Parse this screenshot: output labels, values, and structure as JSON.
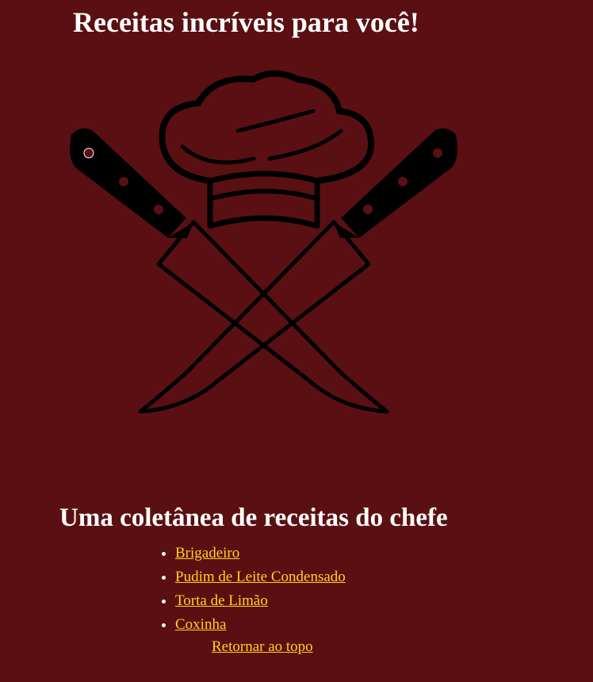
{
  "header": {
    "title": "Receitas incríveis para você!"
  },
  "logo": {
    "icon": "chef-hat-crossed-knives-icon"
  },
  "main": {
    "section_title": "Uma coletânea de receitas do chefe",
    "recipes": [
      {
        "label": "Brigadeiro"
      },
      {
        "label": "Pudim de Leite Condensado"
      },
      {
        "label": "Torta de Limão"
      },
      {
        "label": "Coxinha"
      }
    ],
    "back_to_top": "Retornar ao topo"
  },
  "colors": {
    "background": "#5a1012",
    "text": "#ffffff",
    "link": "#ffd320",
    "logo_ink": "#000000"
  }
}
